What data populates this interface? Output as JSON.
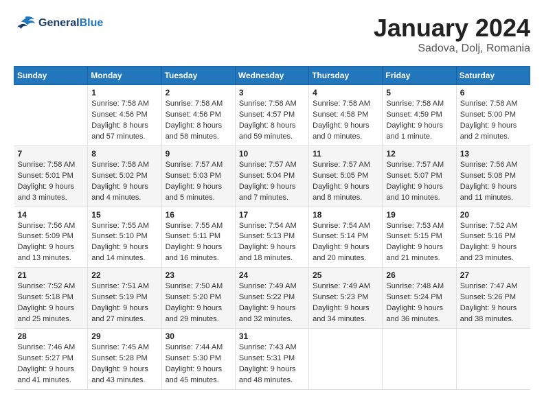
{
  "header": {
    "logo_line1": "General",
    "logo_line2": "Blue",
    "month": "January 2024",
    "location": "Sadova, Dolj, Romania"
  },
  "days_of_week": [
    "Sunday",
    "Monday",
    "Tuesday",
    "Wednesday",
    "Thursday",
    "Friday",
    "Saturday"
  ],
  "weeks": [
    [
      {
        "day": "",
        "info": ""
      },
      {
        "day": "1",
        "info": "Sunrise: 7:58 AM\nSunset: 4:56 PM\nDaylight: 8 hours\nand 57 minutes."
      },
      {
        "day": "2",
        "info": "Sunrise: 7:58 AM\nSunset: 4:56 PM\nDaylight: 8 hours\nand 58 minutes."
      },
      {
        "day": "3",
        "info": "Sunrise: 7:58 AM\nSunset: 4:57 PM\nDaylight: 8 hours\nand 59 minutes."
      },
      {
        "day": "4",
        "info": "Sunrise: 7:58 AM\nSunset: 4:58 PM\nDaylight: 9 hours\nand 0 minutes."
      },
      {
        "day": "5",
        "info": "Sunrise: 7:58 AM\nSunset: 4:59 PM\nDaylight: 9 hours\nand 1 minute."
      },
      {
        "day": "6",
        "info": "Sunrise: 7:58 AM\nSunset: 5:00 PM\nDaylight: 9 hours\nand 2 minutes."
      }
    ],
    [
      {
        "day": "7",
        "info": "Sunrise: 7:58 AM\nSunset: 5:01 PM\nDaylight: 9 hours\nand 3 minutes."
      },
      {
        "day": "8",
        "info": "Sunrise: 7:58 AM\nSunset: 5:02 PM\nDaylight: 9 hours\nand 4 minutes."
      },
      {
        "day": "9",
        "info": "Sunrise: 7:57 AM\nSunset: 5:03 PM\nDaylight: 9 hours\nand 5 minutes."
      },
      {
        "day": "10",
        "info": "Sunrise: 7:57 AM\nSunset: 5:04 PM\nDaylight: 9 hours\nand 7 minutes."
      },
      {
        "day": "11",
        "info": "Sunrise: 7:57 AM\nSunset: 5:05 PM\nDaylight: 9 hours\nand 8 minutes."
      },
      {
        "day": "12",
        "info": "Sunrise: 7:57 AM\nSunset: 5:07 PM\nDaylight: 9 hours\nand 10 minutes."
      },
      {
        "day": "13",
        "info": "Sunrise: 7:56 AM\nSunset: 5:08 PM\nDaylight: 9 hours\nand 11 minutes."
      }
    ],
    [
      {
        "day": "14",
        "info": "Sunrise: 7:56 AM\nSunset: 5:09 PM\nDaylight: 9 hours\nand 13 minutes."
      },
      {
        "day": "15",
        "info": "Sunrise: 7:55 AM\nSunset: 5:10 PM\nDaylight: 9 hours\nand 14 minutes."
      },
      {
        "day": "16",
        "info": "Sunrise: 7:55 AM\nSunset: 5:11 PM\nDaylight: 9 hours\nand 16 minutes."
      },
      {
        "day": "17",
        "info": "Sunrise: 7:54 AM\nSunset: 5:13 PM\nDaylight: 9 hours\nand 18 minutes."
      },
      {
        "day": "18",
        "info": "Sunrise: 7:54 AM\nSunset: 5:14 PM\nDaylight: 9 hours\nand 20 minutes."
      },
      {
        "day": "19",
        "info": "Sunrise: 7:53 AM\nSunset: 5:15 PM\nDaylight: 9 hours\nand 21 minutes."
      },
      {
        "day": "20",
        "info": "Sunrise: 7:52 AM\nSunset: 5:16 PM\nDaylight: 9 hours\nand 23 minutes."
      }
    ],
    [
      {
        "day": "21",
        "info": "Sunrise: 7:52 AM\nSunset: 5:18 PM\nDaylight: 9 hours\nand 25 minutes."
      },
      {
        "day": "22",
        "info": "Sunrise: 7:51 AM\nSunset: 5:19 PM\nDaylight: 9 hours\nand 27 minutes."
      },
      {
        "day": "23",
        "info": "Sunrise: 7:50 AM\nSunset: 5:20 PM\nDaylight: 9 hours\nand 29 minutes."
      },
      {
        "day": "24",
        "info": "Sunrise: 7:49 AM\nSunset: 5:22 PM\nDaylight: 9 hours\nand 32 minutes."
      },
      {
        "day": "25",
        "info": "Sunrise: 7:49 AM\nSunset: 5:23 PM\nDaylight: 9 hours\nand 34 minutes."
      },
      {
        "day": "26",
        "info": "Sunrise: 7:48 AM\nSunset: 5:24 PM\nDaylight: 9 hours\nand 36 minutes."
      },
      {
        "day": "27",
        "info": "Sunrise: 7:47 AM\nSunset: 5:26 PM\nDaylight: 9 hours\nand 38 minutes."
      }
    ],
    [
      {
        "day": "28",
        "info": "Sunrise: 7:46 AM\nSunset: 5:27 PM\nDaylight: 9 hours\nand 41 minutes."
      },
      {
        "day": "29",
        "info": "Sunrise: 7:45 AM\nSunset: 5:28 PM\nDaylight: 9 hours\nand 43 minutes."
      },
      {
        "day": "30",
        "info": "Sunrise: 7:44 AM\nSunset: 5:30 PM\nDaylight: 9 hours\nand 45 minutes."
      },
      {
        "day": "31",
        "info": "Sunrise: 7:43 AM\nSunset: 5:31 PM\nDaylight: 9 hours\nand 48 minutes."
      },
      {
        "day": "",
        "info": ""
      },
      {
        "day": "",
        "info": ""
      },
      {
        "day": "",
        "info": ""
      }
    ]
  ]
}
